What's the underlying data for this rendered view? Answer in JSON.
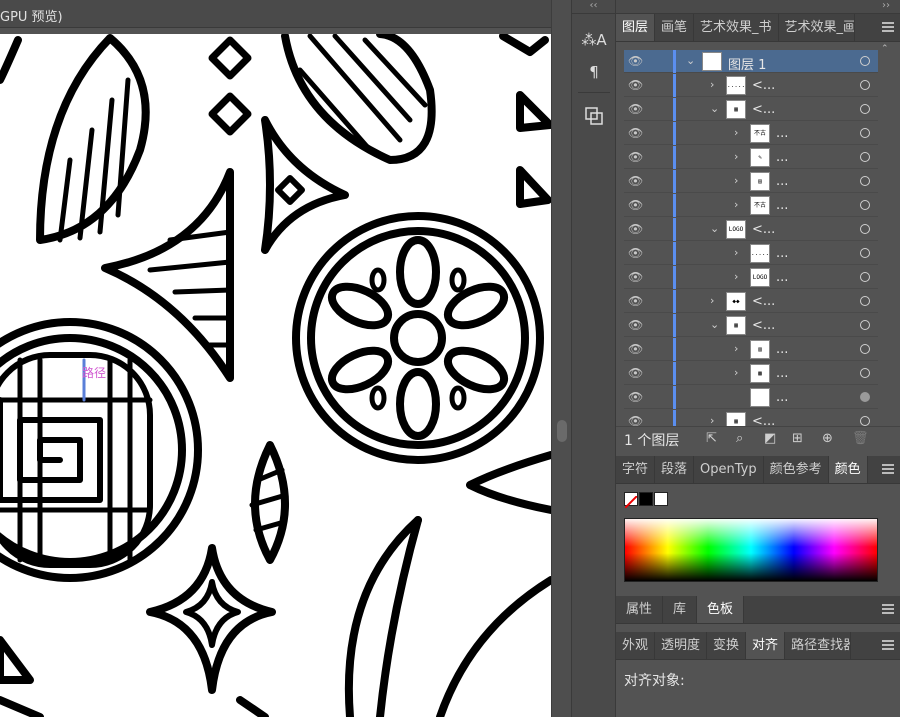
{
  "document": {
    "tab_title": "GPU 预览)"
  },
  "artboard": {
    "path_tooltip": "路径"
  },
  "toolstrip": {
    "collapse": "‹‹"
  },
  "panels_header": {
    "collapse": "››"
  },
  "layers_panel": {
    "tabs": [
      "图层",
      "画笔",
      "艺术效果_书",
      "艺术效果_画"
    ],
    "active_tab": "图层",
    "rows": [
      {
        "indent": 0,
        "expand": "open",
        "thumb": "",
        "name": "图层 1",
        "selected": true,
        "target_filled": false
      },
      {
        "indent": 1,
        "expand": "closed",
        "thumb": "......",
        "name": "<...",
        "selected": false,
        "target_filled": false
      },
      {
        "indent": 1,
        "expand": "open",
        "thumb": "▦",
        "name": "<...",
        "selected": false,
        "target_filled": false
      },
      {
        "indent": 2,
        "expand": "closed",
        "thumb": "不古",
        "name": "...",
        "selected": false,
        "target_filled": false
      },
      {
        "indent": 2,
        "expand": "closed",
        "thumb": "✎",
        "name": "...",
        "selected": false,
        "target_filled": false
      },
      {
        "indent": 2,
        "expand": "closed",
        "thumb": "▤",
        "name": "...",
        "selected": false,
        "target_filled": false
      },
      {
        "indent": 2,
        "expand": "closed",
        "thumb": "不古",
        "name": "...",
        "selected": false,
        "target_filled": false
      },
      {
        "indent": 1,
        "expand": "open",
        "thumb": "LOGO",
        "name": "<...",
        "selected": false,
        "target_filled": false
      },
      {
        "indent": 2,
        "expand": "closed",
        "thumb": "......",
        "name": "...",
        "selected": false,
        "target_filled": false
      },
      {
        "indent": 2,
        "expand": "closed",
        "thumb": "LOGO",
        "name": "...",
        "selected": false,
        "target_filled": false
      },
      {
        "indent": 1,
        "expand": "closed",
        "thumb": "◆◆",
        "name": "<...",
        "selected": false,
        "target_filled": false
      },
      {
        "indent": 1,
        "expand": "open",
        "thumb": "▦",
        "name": "<...",
        "selected": false,
        "target_filled": false
      },
      {
        "indent": 2,
        "expand": "closed",
        "thumb": "▥",
        "name": "...",
        "selected": false,
        "target_filled": false
      },
      {
        "indent": 2,
        "expand": "closed",
        "thumb": "▩",
        "name": "...",
        "selected": false,
        "target_filled": false
      },
      {
        "indent": 2,
        "expand": "none",
        "thumb": "",
        "name": "...",
        "selected": false,
        "target_filled": true
      },
      {
        "indent": 1,
        "expand": "closed",
        "thumb": "▦",
        "name": "<...",
        "selected": false,
        "target_filled": false
      }
    ],
    "footer": {
      "count": "1 个图层"
    }
  },
  "color_panel": {
    "tabs": [
      "字符",
      "段落",
      "OpenTyp",
      "颜色参考",
      "颜色"
    ],
    "active_tab": "颜色"
  },
  "swatch_panel": {
    "tabs": [
      "属性",
      "库",
      "色板"
    ],
    "active_tab": "色板"
  },
  "align_panel": {
    "tabs": [
      "外观",
      "透明度",
      "变换",
      "对齐",
      "路径查找器"
    ],
    "active_tab": "对齐",
    "align_to_label": "对齐对象:"
  }
}
